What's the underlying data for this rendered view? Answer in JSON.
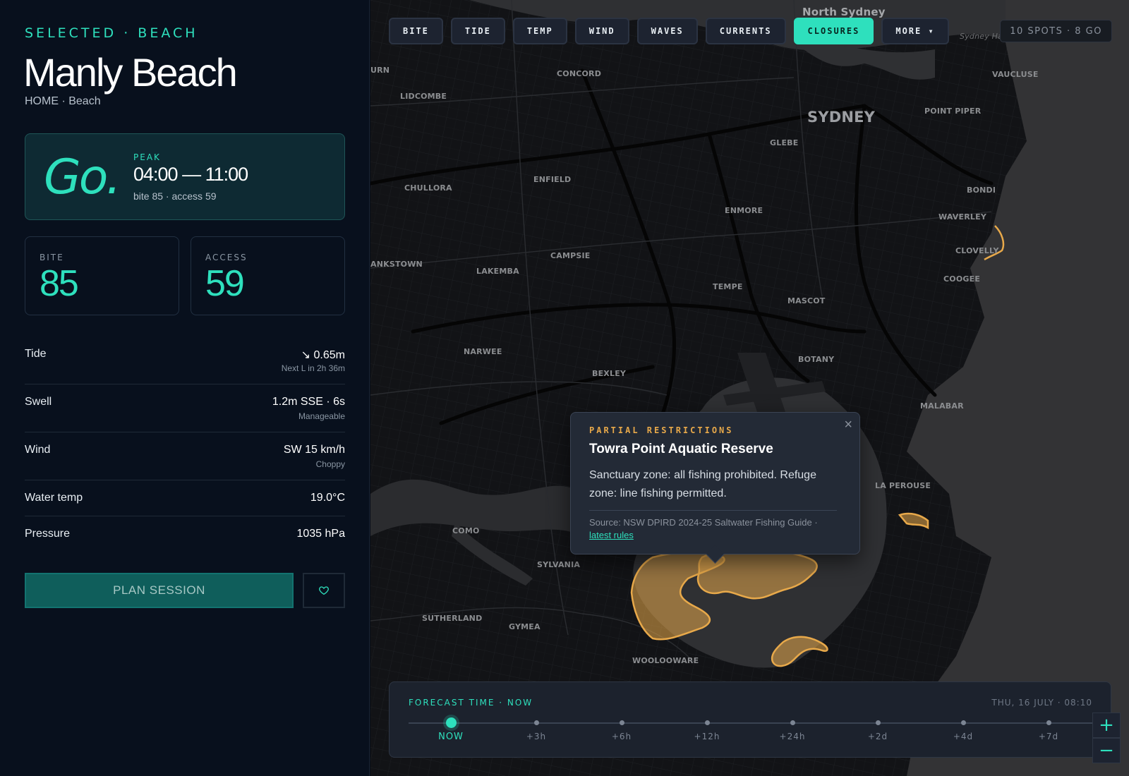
{
  "sidebar": {
    "selected_label": "SELECTED · BEACH",
    "title": "Manly Beach",
    "subtitle": "HOME · Beach",
    "go_card": {
      "verdict": "Go.",
      "peak_label": "PEAK",
      "peak_time": "04:00 — 11:00",
      "peak_sub": "bite 85 · access 59"
    },
    "stats": [
      {
        "label": "BITE",
        "value": "85"
      },
      {
        "label": "ACCESS",
        "value": "59"
      }
    ],
    "conditions": [
      {
        "key": "Tide",
        "value": "↘ 0.65m",
        "sub": "Next L in 2h 36m"
      },
      {
        "key": "Swell",
        "value": "1.2m SSE · 6s",
        "sub": "Manageable"
      },
      {
        "key": "Wind",
        "value": "SW 15 km/h",
        "sub": "Choppy"
      },
      {
        "key": "Water temp",
        "value": "19.0°C",
        "sub": ""
      },
      {
        "key": "Pressure",
        "value": "1035 hPa",
        "sub": ""
      }
    ],
    "plan_button": "PLAN SESSION",
    "favorite_icon": "heart-icon"
  },
  "map": {
    "tabs": [
      "BITE",
      "TIDE",
      "TEMP",
      "WIND",
      "WAVES",
      "CURRENTS",
      "CLOSURES",
      "MORE ▾"
    ],
    "active_tab": "CLOSURES",
    "spots_badge": "10 SPOTS · 8 GO",
    "places": {
      "north_sydney": "North Sydney",
      "sydney_harbour": "Sydney Harbour",
      "urn": "URN",
      "concord": "CONCORD",
      "vaucluse": "VAUCLUSE",
      "lidcombe": "LIDCOMBE",
      "sydney": "SYDNEY",
      "point_piper": "POINT PIPER",
      "glebe": "GLEBE",
      "enfield": "ENFIELD",
      "chullora": "CHULLORA",
      "bondi": "BONDI",
      "enmore": "ENMORE",
      "waverley": "WAVERLEY",
      "clovelly": "CLOVELLY",
      "campsie": "CAMPSIE",
      "bankstown": "ANKSTOWN",
      "lakemba": "LAKEMBA",
      "coogee": "COOGEE",
      "tempe": "TEMPE",
      "mascot": "MASCOT",
      "narwee": "NARWEE",
      "botany": "BOTANY",
      "bexley": "BEXLEY",
      "malabar": "MALABAR",
      "la_perouse": "LA PEROUSE",
      "como": "COMO",
      "sylvania": "SYLVANIA",
      "sutherland": "SUTHERLAND",
      "gymea": "GYMEA",
      "woolooware": "WOOLOOWARE"
    },
    "popup": {
      "tag": "PARTIAL RESTRICTIONS",
      "title": "Towra Point Aquatic Reserve",
      "description": "Sanctuary zone: all fishing prohibited. Refuge zone: line fishing permitted.",
      "source": "Source: NSW DPIRD 2024-25 Saltwater Fishing Guide ·",
      "link": "latest rules",
      "close": "×"
    },
    "forecast": {
      "title": "FORECAST TIME · NOW",
      "date": "THU, 16 JULY · 08:10",
      "stops": [
        "NOW",
        "+3h",
        "+6h",
        "+12h",
        "+24h",
        "+2d",
        "+4d",
        "+7d"
      ],
      "selected": "NOW"
    },
    "zoom": {
      "in": "+",
      "out": "−"
    },
    "colors": {
      "accent": "#2ee0bd",
      "closure": "#e8a94a"
    }
  }
}
